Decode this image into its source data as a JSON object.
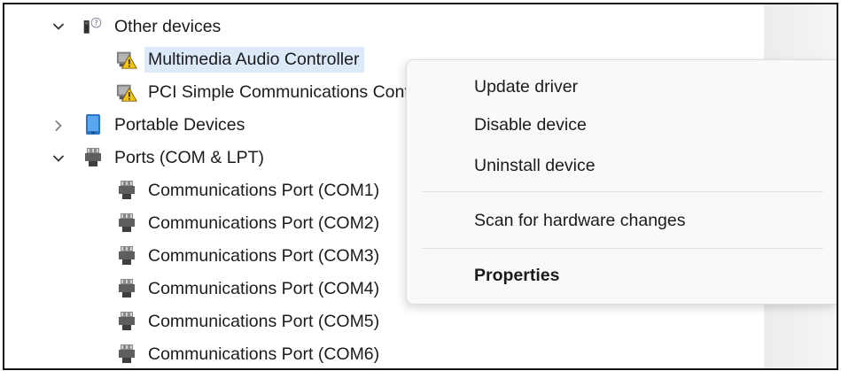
{
  "tree": {
    "other_devices": {
      "label": "Other devices",
      "expanded": true,
      "icon": "unknown-device-icon"
    },
    "multimedia_audio": {
      "label": "Multimedia Audio Controller",
      "selected": true,
      "icon": "warning-device-icon"
    },
    "pci_simple": {
      "label": "PCI Simple Communications Controller",
      "icon": "warning-device-icon"
    },
    "portable_devices": {
      "label": "Portable Devices",
      "expanded": false,
      "icon": "portable-device-icon"
    },
    "ports": {
      "label": "Ports (COM & LPT)",
      "expanded": true,
      "icon": "port-icon"
    },
    "ports_children": [
      {
        "label": "Communications Port (COM1)"
      },
      {
        "label": "Communications Port (COM2)"
      },
      {
        "label": "Communications Port (COM3)"
      },
      {
        "label": "Communications Port (COM4)"
      },
      {
        "label": "Communications Port (COM5)"
      },
      {
        "label": "Communications Port (COM6)"
      }
    ]
  },
  "context_menu": {
    "update_driver": "Update driver",
    "disable_device": "Disable device",
    "uninstall_device": "Uninstall device",
    "scan_hardware": "Scan for hardware changes",
    "properties": "Properties"
  },
  "colors": {
    "selection": "#dbe9f8",
    "warning": "#f2c511",
    "menu_background": "#f9f9f9"
  }
}
